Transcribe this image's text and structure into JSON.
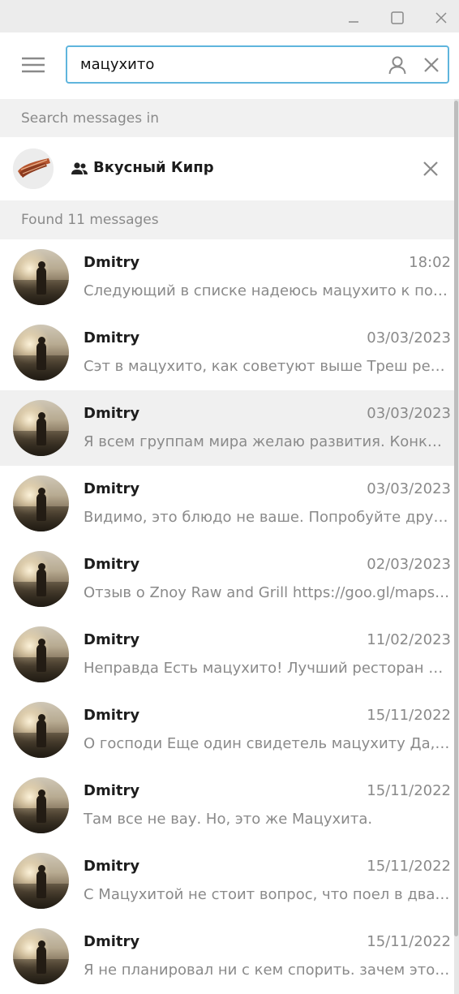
{
  "search": {
    "query": "мацухито"
  },
  "section_search_in": "Search messages in",
  "chat": {
    "name": "Вкусный Кипр"
  },
  "found_label": "Found 11 messages",
  "results": [
    {
      "sender": "Dmitry",
      "date": "18:02",
      "snippet": "Следующий в списке надеюсь мацухито к после"
    },
    {
      "sender": "Dmitry",
      "date": "03/03/2023",
      "snippet": "Сэт в мацухито, как советуют выше  Треш ресторан"
    },
    {
      "sender": "Dmitry",
      "date": "03/03/2023",
      "snippet": "Я всем группам мира желаю развития.  Конкретно"
    },
    {
      "sender": "Dmitry",
      "date": "03/03/2023",
      "snippet": "Видимо, это блюдо не ваше. Попробуйте другое"
    },
    {
      "sender": "Dmitry",
      "date": "02/03/2023",
      "snippet": "Отзыв о Znoy Raw and Grill https://goo.gl/maps/abc"
    },
    {
      "sender": "Dmitry",
      "date": "11/02/2023",
      "snippet": "Неправда  Есть мацухито! Лучший ресторан в городе"
    },
    {
      "sender": "Dmitry",
      "date": "15/11/2022",
      "snippet": "О господи  Еще один свидетель мацухиту  Да, это так"
    },
    {
      "sender": "Dmitry",
      "date": "15/11/2022",
      "snippet": "Там все не вау. Но, это же Мацухита."
    },
    {
      "sender": "Dmitry",
      "date": "15/11/2022",
      "snippet": "С Мацухитой не стоит вопрос, что поел в два раза"
    },
    {
      "sender": "Dmitry",
      "date": "15/11/2022",
      "snippet": "Я не планировал ни с кем спорить. зачем это все"
    }
  ],
  "active_index": 2,
  "colors": {
    "accent": "#5fb5dd",
    "section_bg": "#f1f1f1",
    "muted_text": "#8a8a8a"
  }
}
